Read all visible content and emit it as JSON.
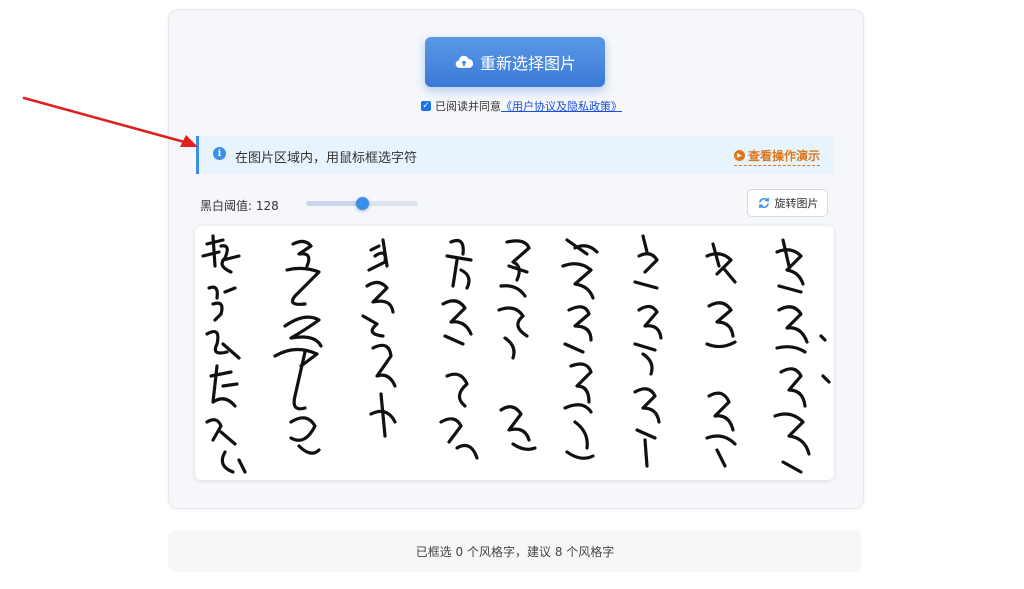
{
  "upload": {
    "label": "重新选择图片",
    "icon": "cloud-upload-icon"
  },
  "agreement": {
    "checked": true,
    "prefix": "已阅读并同意",
    "link_text": "《用户协议及隐私政策》"
  },
  "info": {
    "text": "在图片区域内，用鼠标框选字符",
    "icon": "info-icon",
    "demo_link": "查看操作演示",
    "demo_icon": "play-icon"
  },
  "threshold": {
    "label": "黑白阈值: 128",
    "value": 128,
    "min": 0,
    "max": 255
  },
  "rotate": {
    "label": "旋转图片",
    "icon": "refresh-icon"
  },
  "status": {
    "text": "已框选 0 个风格字，建议 8 个风格字"
  },
  "colors": {
    "accent": "#3b8eea",
    "link": "#1a4fd6",
    "demo": "#d9781c",
    "annotation_arrow": "#e02020"
  }
}
